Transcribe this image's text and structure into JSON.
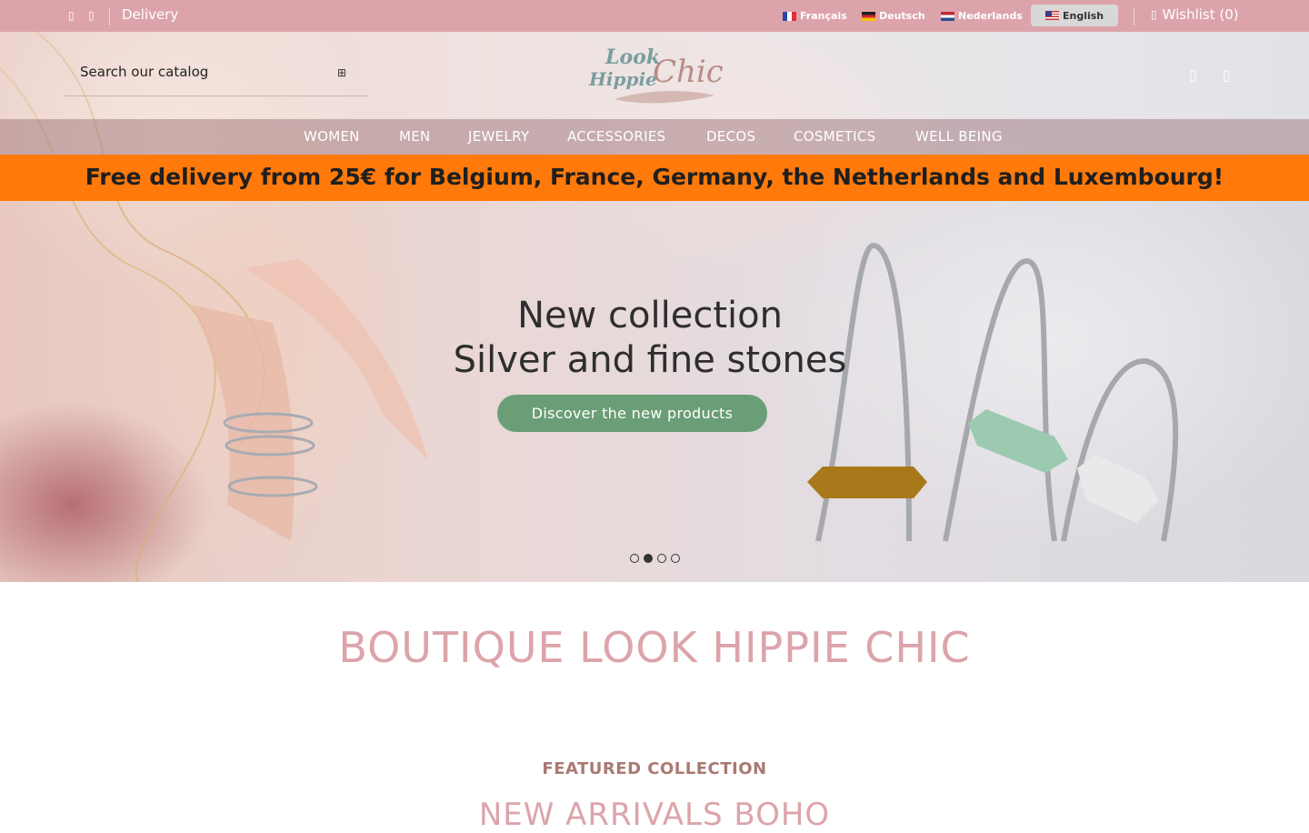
{
  "topbar": {
    "icon_1": "facebook-icon",
    "icon_2": "instagram-icon",
    "delivery": "Delivery",
    "languages": [
      {
        "label": "Français",
        "flag": "fr",
        "active": false
      },
      {
        "label": "Deutsch",
        "flag": "de",
        "active": false
      },
      {
        "label": "Nederlands",
        "flag": "nl",
        "active": false
      },
      {
        "label": "English",
        "flag": "en",
        "active": true
      }
    ],
    "wishlist": "Wishlist (0)"
  },
  "header": {
    "search_placeholder": "Search our catalog",
    "logo": {
      "line1": "Look",
      "line2": "Hippie",
      "line3": "Chic"
    }
  },
  "nav": {
    "items": [
      "WOMEN",
      "MEN",
      "JEWELRY",
      "ACCESSORIES",
      "DECOS",
      "COSMETICS",
      "WELL BEING"
    ]
  },
  "banner": {
    "text": "Free delivery from 25€ for Belgium, France, Germany, the Netherlands and Luxembourg!"
  },
  "slider": {
    "title_line1": "New collection",
    "title_line2": "Silver and fine stones",
    "cta": "Discover the new products",
    "slides": 4,
    "active_slide": 2
  },
  "main": {
    "title": "BOUTIQUE LOOK HIPPIE CHIC",
    "featured_label": "FEATURED COLLECTION",
    "featured_title": "NEW ARRIVALS BOHO"
  },
  "colors": {
    "topbar": "#dca4aa",
    "banner": "#ff7a0a",
    "cta": "#6a9e76",
    "accent_text": "#dca4aa"
  }
}
